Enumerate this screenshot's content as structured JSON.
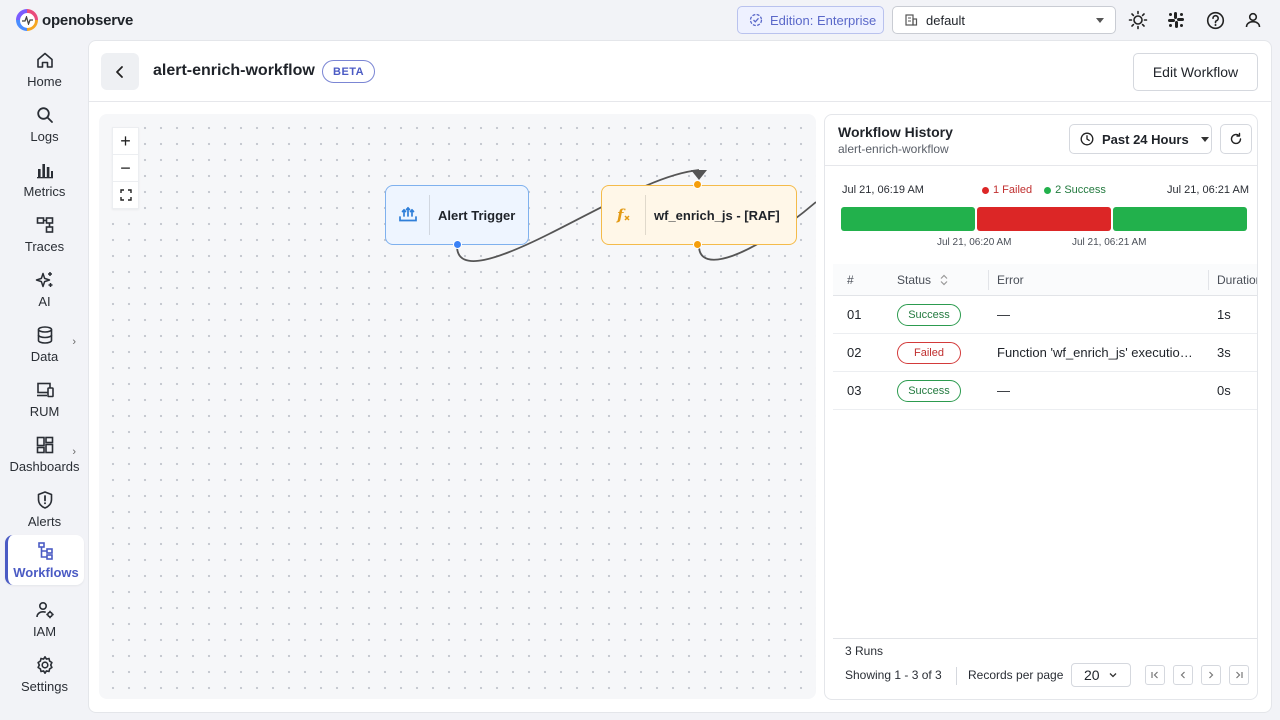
{
  "app": {
    "logo_text": "openobserve",
    "edition_label": "Edition: Enterprise",
    "org_selected": "default"
  },
  "sidebar": {
    "items": [
      {
        "label": "Home",
        "icon": "home-icon"
      },
      {
        "label": "Logs",
        "icon": "search-icon"
      },
      {
        "label": "Metrics",
        "icon": "bar-chart-icon"
      },
      {
        "label": "Traces",
        "icon": "traces-icon"
      },
      {
        "label": "AI",
        "icon": "sparkle-icon"
      },
      {
        "label": "Data",
        "icon": "database-icon"
      },
      {
        "label": "RUM",
        "icon": "devices-icon"
      },
      {
        "label": "Dashboards",
        "icon": "dashboard-icon"
      },
      {
        "label": "Alerts",
        "icon": "alert-shield-icon"
      },
      {
        "label": "Workflows",
        "icon": "workflow-icon"
      },
      {
        "label": "IAM",
        "icon": "user-gear-icon"
      },
      {
        "label": "Settings",
        "icon": "gear-icon"
      }
    ]
  },
  "header": {
    "title": "alert-enrich-workflow",
    "badge": "BETA",
    "edit_button": "Edit Workflow"
  },
  "canvas": {
    "zoom_in": "+",
    "zoom_out": "−",
    "nodes": {
      "trigger_label": "Alert Trigger",
      "function_label": "wf_enrich_js - [RAF]"
    },
    "colors": {
      "trigger_handle": "#3b82f6",
      "function_handle": "#f59e0b"
    }
  },
  "history": {
    "title": "Workflow History",
    "subtitle": "alert-enrich-workflow",
    "range_label": "Past 24 Hours",
    "timeline": {
      "start_label": "Jul 21, 06:19 AM",
      "end_label": "Jul 21, 06:21 AM",
      "failed_legend": "1 Failed",
      "success_legend": "2 Success",
      "tick_1": "Jul 21, 06:20 AM",
      "tick_2": "Jul 21, 06:21 AM",
      "bars": [
        "success",
        "failed",
        "success"
      ],
      "colors": {
        "success": "#22b14c",
        "failed": "#dc2626"
      }
    },
    "table": {
      "headers": {
        "num": "#",
        "status": "Status",
        "error": "Error",
        "duration": "Duration"
      },
      "rows": [
        {
          "num": "01",
          "status": "Success",
          "error": "—",
          "duration": "1s"
        },
        {
          "num": "02",
          "status": "Failed",
          "error": "Function 'wf_enrich_js' execution failed",
          "duration": "3s"
        },
        {
          "num": "03",
          "status": "Success",
          "error": "—",
          "duration": "0s"
        }
      ]
    },
    "footer": {
      "runs": "3 Runs",
      "showing": "Showing 1 - 3 of 3",
      "rpp_label": "Records per page",
      "rpp_value": "20"
    }
  }
}
